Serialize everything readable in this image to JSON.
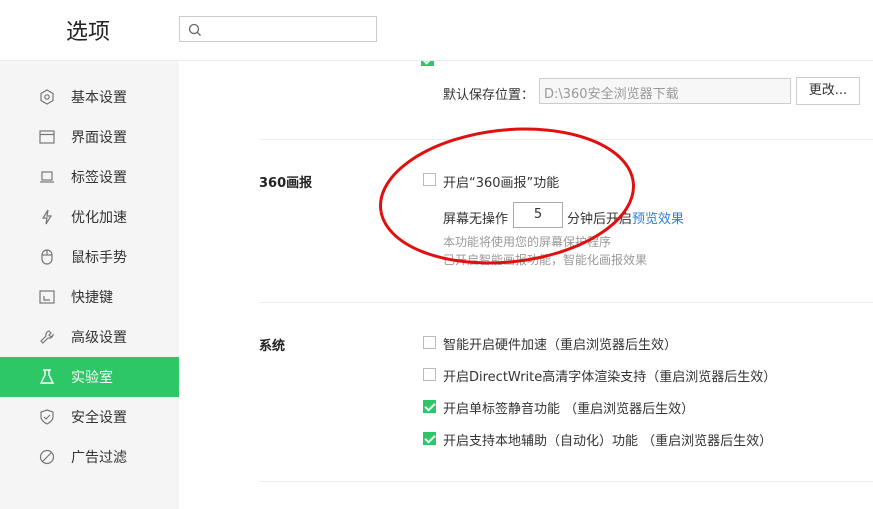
{
  "header": {
    "title": "选项",
    "search_placeholder": ""
  },
  "sidebar": {
    "items": [
      {
        "label": "基本设置",
        "icon": "hexagon-gear-icon"
      },
      {
        "label": "界面设置",
        "icon": "window-icon"
      },
      {
        "label": "标签设置",
        "icon": "tab-icon"
      },
      {
        "label": "优化加速",
        "icon": "lightning-icon"
      },
      {
        "label": "鼠标手势",
        "icon": "mouse-icon"
      },
      {
        "label": "快捷键",
        "icon": "keyboard-icon"
      },
      {
        "label": "高级设置",
        "icon": "wrench-icon"
      },
      {
        "label": "实验室",
        "icon": "flask-icon"
      },
      {
        "label": "安全设置",
        "icon": "shield-icon"
      },
      {
        "label": "广告过滤",
        "icon": "block-icon"
      }
    ],
    "active": "实验室"
  },
  "download": {
    "label": "默认保存位置：",
    "path": "D:\\360安全浏览器下载",
    "change_button": "更改..."
  },
  "huabao": {
    "section_title": "360画报",
    "enable_label": "开启“360画报”功能",
    "enabled": false,
    "idle_prefix": "屏幕无操作",
    "idle_minutes": "5",
    "idle_suffix": "分钟后开启",
    "preview_link": "预览效果",
    "note1": "本功能将使用您的屏幕保护程序",
    "note2": "已开启智能画报功能，智能化画报效果"
  },
  "system": {
    "section_title": "系统",
    "options": [
      {
        "label": "智能开启硬件加速（重启浏览器后生效）",
        "checked": false
      },
      {
        "label": "开启DirectWrite高清字体渲染支持（重启浏览器后生效）",
        "checked": false
      },
      {
        "label": "开启单标签静音功能 （重启浏览器后生效）",
        "checked": true
      },
      {
        "label": "开启支持本地辅助（自动化）功能 （重启浏览器后生效）",
        "checked": true
      }
    ]
  },
  "colors": {
    "accent": "#2dc766",
    "link": "#2d7fd5",
    "annotation": "#e01010"
  }
}
